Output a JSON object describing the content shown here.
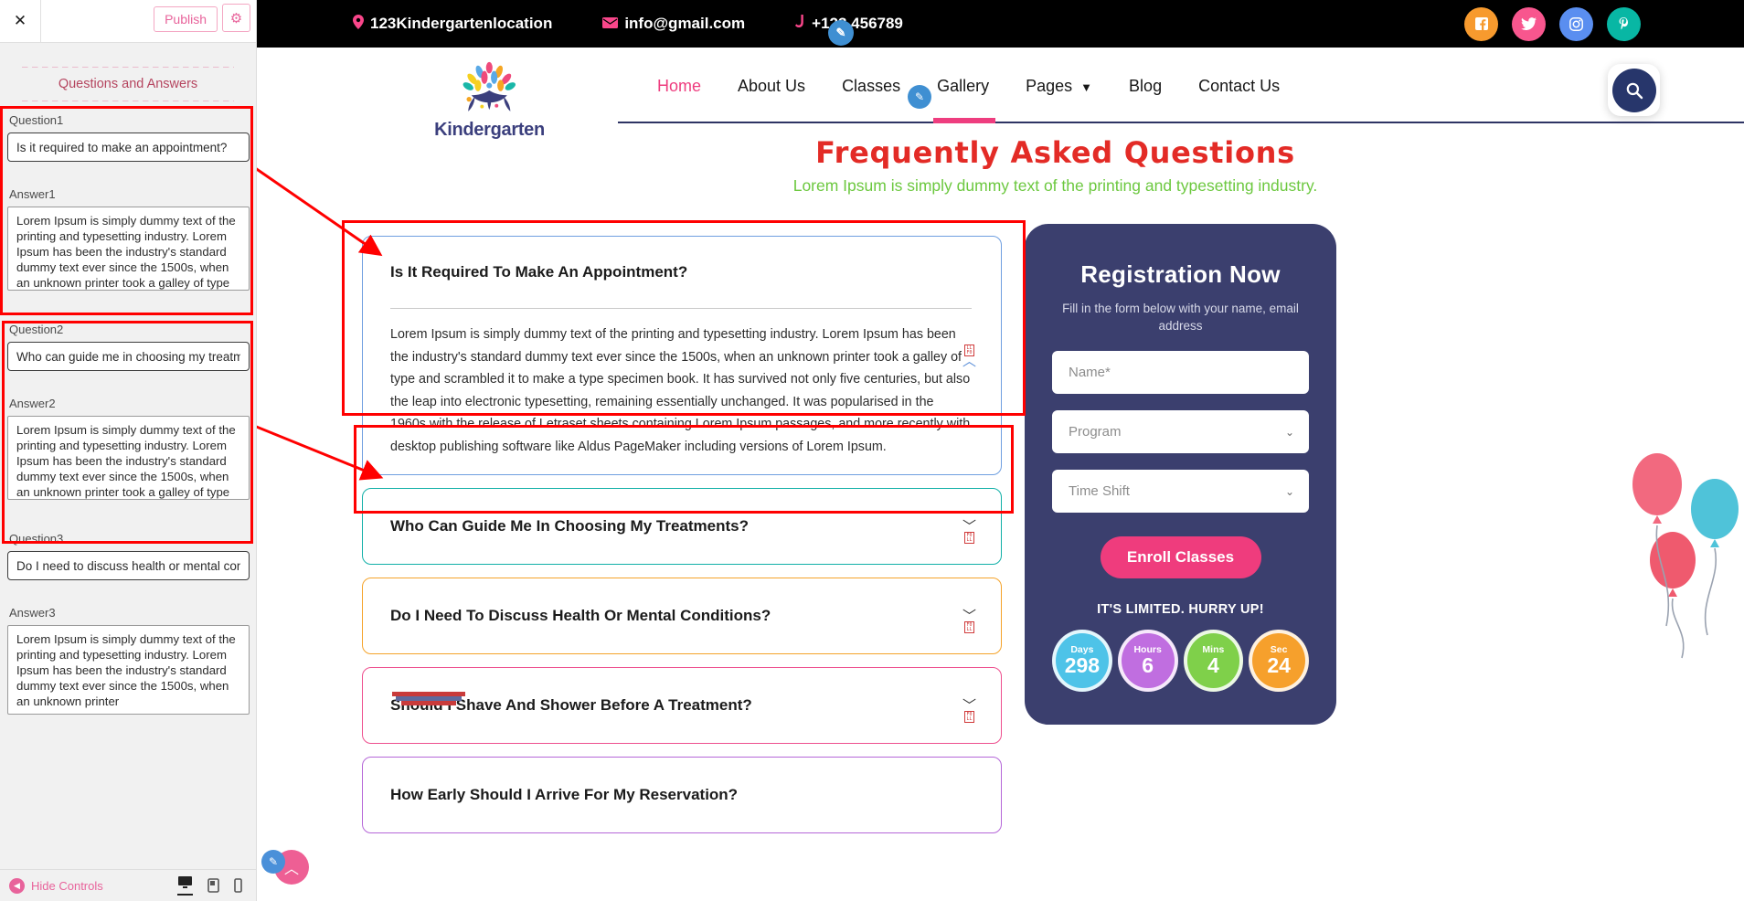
{
  "editor": {
    "close_icon": "✕",
    "publish_label": "Publish",
    "gear_icon": "⚙",
    "section_heading": "Questions and Answers",
    "fields": [
      {
        "label": "Question1",
        "value": "Is it required to make an appointment?"
      },
      {
        "label": "Answer1",
        "value": "Lorem Ipsum is simply dummy text of the printing and typesetting industry. Lorem Ipsum has been the industry's standard dummy text ever since the 1500s, when an unknown printer took a galley of type and scrambled it to make a"
      },
      {
        "label": "Question2",
        "value": "Who can guide me in choosing my treatments?"
      },
      {
        "label": "Answer2",
        "value": "Lorem Ipsum is simply dummy text of the printing and typesetting industry. Lorem Ipsum has been the industry's standard dummy text ever since the 1500s, when an unknown printer took a galley of type and scrambled it to make a"
      },
      {
        "label": "Question3",
        "value": "Do I need to discuss health or mental conditions?"
      },
      {
        "label": "Answer3",
        "value": "Lorem Ipsum is simply dummy text of the printing and typesetting industry. Lorem Ipsum has been the industry's standard dummy text ever since the 1500s, when an unknown printer"
      }
    ],
    "bottom": {
      "hide_controls_label": "Hide Controls",
      "back_icon": "◀",
      "desktop_icon": "desktop-icon",
      "tablet_icon": "tablet-icon",
      "mobile_icon": "mobile-icon"
    },
    "fab_pencil_icon": "✎",
    "scroll_top_icon": "︿"
  },
  "topbar": {
    "location": "123Kindergartenlocation",
    "email": "info@gmail.com",
    "phone": "+123 456789",
    "location_icon": "📍",
    "email_icon": "✉",
    "phone_icon": "✆",
    "accent": "#f9468a",
    "socials": [
      {
        "name": "facebook",
        "glyph": "f",
        "color": "#f79a2e"
      },
      {
        "name": "twitter",
        "glyph": "🐦",
        "color": "#f8568e"
      },
      {
        "name": "instagram",
        "glyph": "◉",
        "color": "#5a8ef0"
      },
      {
        "name": "pinterest",
        "glyph": "P",
        "color": "#08b7a4"
      }
    ]
  },
  "header": {
    "logo_text": "Kindergarten",
    "nav": [
      {
        "label": "Home",
        "active": true
      },
      {
        "label": "About Us",
        "active": false
      },
      {
        "label": "Classes",
        "active": false
      },
      {
        "label": "Gallery",
        "active": false
      },
      {
        "label": "Pages",
        "active": false,
        "caret": "❯"
      },
      {
        "label": "Blog",
        "active": false
      },
      {
        "label": "Contact Us",
        "active": false
      }
    ],
    "search_icon": "🔍",
    "search_color": "#27366b"
  },
  "hero": {
    "title": "Frequently Asked Questions",
    "subtitle": "Lorem Ipsum is simply dummy text of the printing and typesetting industry.",
    "title_color": "#e32b26",
    "subtitle_color": "#6cc83f"
  },
  "faq": {
    "tofu_glyph_top": "LL",
    "tofu_glyph_bottom": "F0",
    "items": [
      {
        "question": "Is It Required To Make An Appointment?",
        "answer": "Lorem Ipsum is simply dummy text of the printing and typesetting industry. Lorem Ipsum has been the industry's standard dummy text ever since the 1500s, when an unknown printer took a galley of type and scrambled it to make a type specimen book. It has survived not only five centuries, but also the leap into electronic typesetting, remaining essentially unchanged. It was popularised in the 1960s with the release of Letraset sheets containing Lorem Ipsum passages, and more recently with desktop publishing software like Aldus PageMaker including versions of Lorem Ipsum.",
        "open": true,
        "border": "#6f9fe0",
        "chevron": "︿"
      },
      {
        "question": "Who Can Guide Me In Choosing My Treatments?",
        "answer": "",
        "open": false,
        "border": "#12b0a8",
        "chevron": "﹀"
      },
      {
        "question": "Do I Need To Discuss Health Or Mental Conditions?",
        "answer": "",
        "open": false,
        "border": "#f5a32a",
        "chevron": "﹀"
      },
      {
        "question": "Should I Shave And Shower Before A Treatment?",
        "answer": "",
        "open": false,
        "border": "#ee4f8e",
        "chevron": "﹀"
      },
      {
        "question": "How Early Should I Arrive For My Reservation?",
        "answer": "",
        "open": false,
        "border": "#b567d8",
        "chevron": "﹀"
      }
    ]
  },
  "registration": {
    "title": "Registration Now",
    "subtitle": "Fill in the form below with your name, email address",
    "name_placeholder": "Name*",
    "program_placeholder": "Program",
    "timeshift_placeholder": "Time Shift",
    "caret_icon": "⌄",
    "enroll_label": "Enroll Classes",
    "limited_text": "IT'S LIMITED. HURRY UP!",
    "counters": [
      {
        "label": "Days",
        "value": "298",
        "color": "#4ec3e8"
      },
      {
        "label": "Hours",
        "value": "6",
        "color": "#c06ee0"
      },
      {
        "label": "Mins",
        "value": "4",
        "color": "#7fd04a"
      },
      {
        "label": "Sec",
        "value": "24",
        "color": "#f6a02c"
      }
    ]
  }
}
